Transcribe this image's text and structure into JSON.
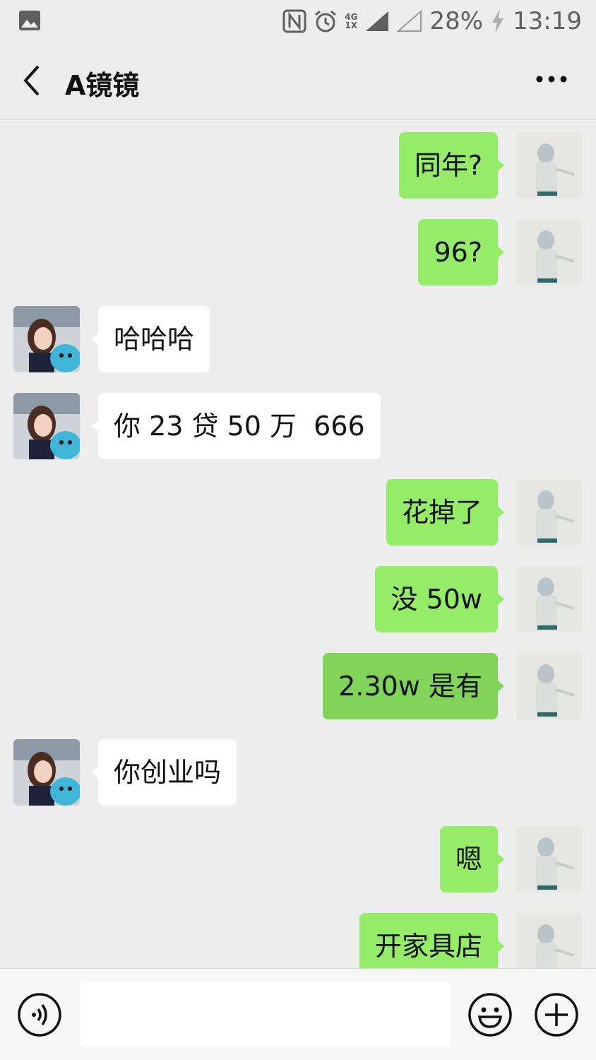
{
  "status_bar": {
    "gallery_icon": "image-icon",
    "network_top": "4G",
    "network_bottom": "1X",
    "battery": "28%",
    "time": "13:19"
  },
  "header": {
    "back_icon": "chevron-left-icon",
    "title": "A镜镜",
    "more_icon": "more-dots-icon"
  },
  "messages": [
    {
      "side": "out",
      "text": "同年?"
    },
    {
      "side": "out",
      "text": "96?"
    },
    {
      "side": "in",
      "text": "哈哈哈"
    },
    {
      "side": "in",
      "text": "你 23 贷 50 万  666"
    },
    {
      "side": "out",
      "text": "花掉了"
    },
    {
      "side": "out",
      "text": "没 50w"
    },
    {
      "side": "out",
      "text": "2.30w 是有"
    },
    {
      "side": "in",
      "text": "你创业吗"
    },
    {
      "side": "out",
      "text": "嗯"
    },
    {
      "side": "out",
      "text": "开家具店"
    }
  ],
  "input_bar": {
    "voice_icon": "voice-icon",
    "message_value": "",
    "emoji_icon": "smiley-icon",
    "plus_icon": "plus-circle-icon"
  },
  "colors": {
    "sent_bubble": "#95EC69",
    "received_bubble": "#FFFFFF",
    "background": "#EDEDED"
  }
}
